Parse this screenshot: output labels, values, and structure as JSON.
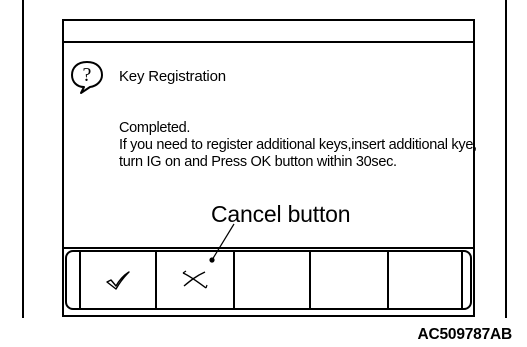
{
  "dialog": {
    "title": "Key Registration",
    "icon": "question-icon",
    "message_lines": [
      "Completed.",
      "If you need to register additional keys,insert additional kye,",
      "turn IG on and Press OK button within 30sec."
    ]
  },
  "buttons": [
    {
      "name": "ok-button",
      "icon": "checkmark-icon"
    },
    {
      "name": "cancel-button",
      "icon": "cross-icon"
    },
    {
      "name": "blank-button-1",
      "icon": ""
    },
    {
      "name": "blank-button-2",
      "icon": ""
    },
    {
      "name": "blank-button-3",
      "icon": ""
    }
  ],
  "annotation": {
    "callout_text": "Cancel button"
  },
  "figure_id": "AC509787AB"
}
